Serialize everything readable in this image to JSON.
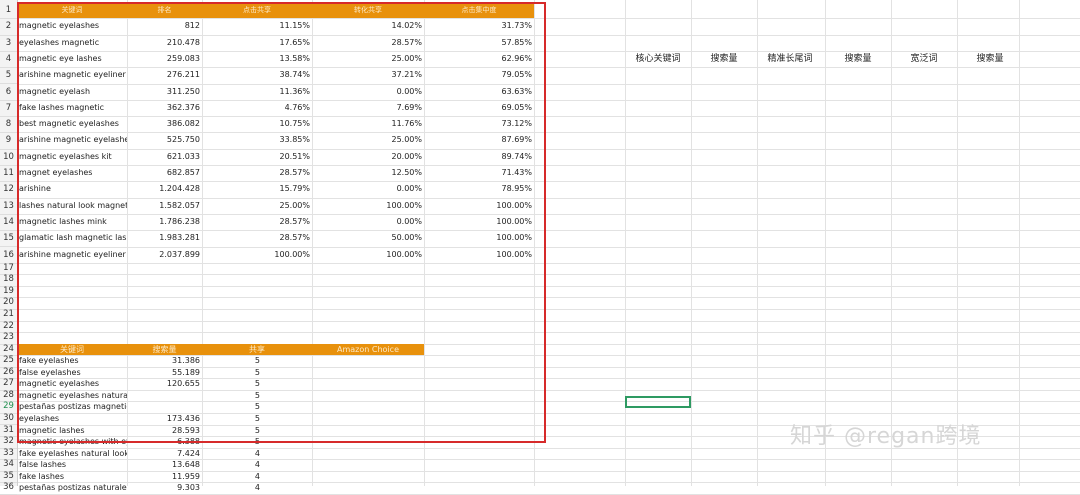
{
  "table1": {
    "headers": [
      "关键词",
      "排名",
      "点击共享",
      "转化共享",
      "点击集中度"
    ],
    "rows": [
      [
        "magnetic eyelashes",
        "812",
        "11.15%",
        "14.02%",
        "31.73%"
      ],
      [
        "eyelashes magnetic",
        "210.478",
        "17.65%",
        "28.57%",
        "57.85%"
      ],
      [
        "magnetic eye lashes",
        "259.083",
        "13.58%",
        "25.00%",
        "62.96%"
      ],
      [
        "arishine magnetic eyeliner and",
        "276.211",
        "38.74%",
        "37.21%",
        "79.05%"
      ],
      [
        "magnetic eyelash",
        "311.250",
        "11.36%",
        "0.00%",
        "63.63%"
      ],
      [
        "fake lashes magnetic",
        "362.376",
        "4.76%",
        "7.69%",
        "69.05%"
      ],
      [
        "best magnetic eyelashes",
        "386.082",
        "10.75%",
        "11.76%",
        "73.12%"
      ],
      [
        "arishine magnetic eyelashes",
        "525.750",
        "33.85%",
        "25.00%",
        "87.69%"
      ],
      [
        "magnetic eyelashes kit",
        "621.033",
        "20.51%",
        "20.00%",
        "89.74%"
      ],
      [
        "magnet eyelashes",
        "682.857",
        "28.57%",
        "12.50%",
        "71.43%"
      ],
      [
        "arishine",
        "1.204.428",
        "15.79%",
        "0.00%",
        "78.95%"
      ],
      [
        "lashes natural look magnetic",
        "1.582.057",
        "25.00%",
        "100.00%",
        "100.00%"
      ],
      [
        "magnetic lashes mink",
        "1.786.238",
        "28.57%",
        "0.00%",
        "100.00%"
      ],
      [
        "glamatic lash magnetic lashes",
        "1.983.281",
        "28.57%",
        "50.00%",
        "100.00%"
      ],
      [
        "arishine magnetic eyeliner and",
        "2.037.899",
        "100.00%",
        "100.00%",
        "100.00%"
      ]
    ]
  },
  "table2": {
    "headers": [
      "关键词",
      "搜索量",
      "共享",
      "Amazon Choice"
    ],
    "rows": [
      [
        "fake eyelashes",
        "31.386",
        "5"
      ],
      [
        "false eyelashes",
        "55.189",
        "5"
      ],
      [
        "magnetic eyelashes",
        "120.655",
        "5"
      ],
      [
        "magnetic eyelashes natural loc",
        "",
        "5"
      ],
      [
        "pestañas postizas magneticas",
        "",
        "5"
      ],
      [
        "eyelashes",
        "173.436",
        "5"
      ],
      [
        "magnetic lashes",
        "28.593",
        "5"
      ],
      [
        "magnetic eyelashes with eyelin",
        "6.388",
        "5"
      ],
      [
        "fake eyelashes natural look",
        "7.424",
        "4"
      ],
      [
        "false lashes",
        "13.648",
        "4"
      ],
      [
        "fake lashes",
        "11.959",
        "4"
      ],
      [
        "pestañas postizas naturales",
        "9.303",
        "4"
      ]
    ]
  },
  "right_headers": [
    "核心关键词",
    "搜索量",
    "精准长尾词",
    "搜索量",
    "宽泛词",
    "搜索量"
  ],
  "row_numbers": [
    "1",
    "2",
    "3",
    "4",
    "5",
    "6",
    "7",
    "8",
    "9",
    "10",
    "11",
    "12",
    "13",
    "14",
    "15",
    "16",
    "17",
    "18",
    "19",
    "20",
    "21",
    "22",
    "23",
    "24",
    "25",
    "26",
    "27",
    "28",
    "29",
    "30",
    "31",
    "32",
    "33",
    "34",
    "35",
    "36"
  ],
  "watermark": "知乎 @regan跨境",
  "colors": {
    "header_fill": "#e8910c",
    "red_box": "#d62a2a",
    "selection": "#2e9a62"
  }
}
